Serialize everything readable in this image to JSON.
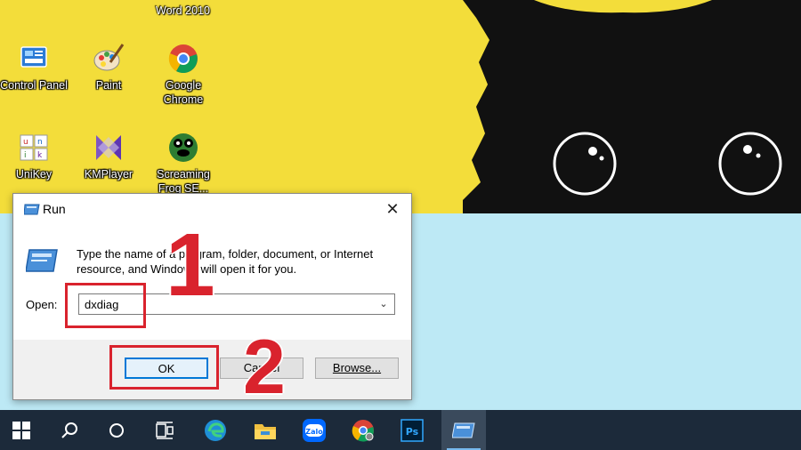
{
  "desktop": {
    "icons": [
      {
        "label": "Control Panel",
        "icon": "control-panel-icon"
      },
      {
        "label": "Paint",
        "icon": "paint-icon"
      },
      {
        "label": "Google Chrome",
        "icon": "chrome-icon"
      },
      {
        "label": "UniKey",
        "icon": "unikey-icon"
      },
      {
        "label": "KMPlayer",
        "icon": "kmplayer-icon"
      },
      {
        "label": "Screaming Frog SE...",
        "icon": "screaming-frog-icon"
      }
    ],
    "partial_top_label": "Word 2010"
  },
  "run_dialog": {
    "title": "Run",
    "description": "Type the name of a program, folder, document, or Internet resource, and Windows will open it for you.",
    "open_label": "Open:",
    "open_value": "dxdiag",
    "ok_label": "OK",
    "cancel_label": "Cancel",
    "browse_label": "Browse..."
  },
  "annotations": {
    "step1": "1",
    "step2": "2",
    "color": "#d9232d"
  },
  "taskbar": {
    "items": [
      "start-icon",
      "search-icon",
      "cortana-icon",
      "task-view-icon",
      "edge-icon",
      "file-explorer-icon",
      "zalo-icon",
      "chrome-icon",
      "photoshop-icon",
      "run-icon"
    ],
    "zalo_text": "Zalo",
    "ps_text": "Ps"
  }
}
